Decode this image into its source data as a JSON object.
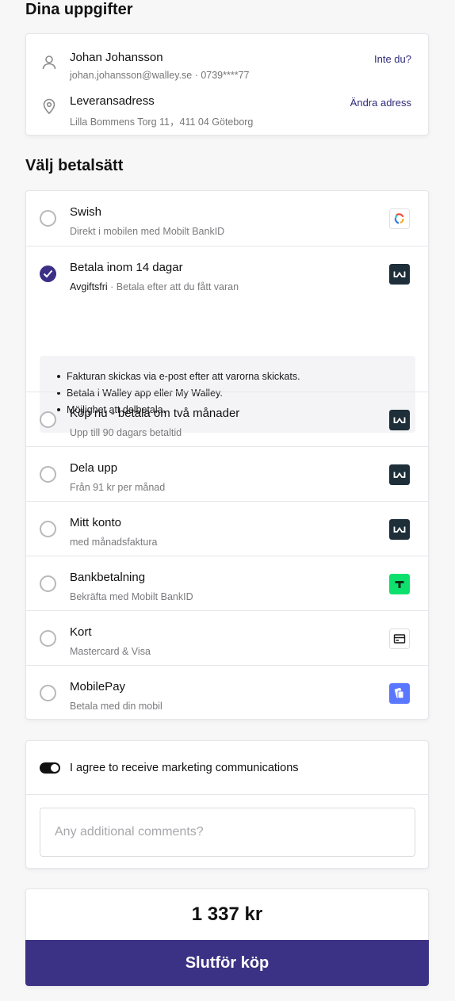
{
  "details": {
    "heading": "Dina uppgifter",
    "name": "Johan Johansson",
    "contact": "johan.johansson@walley.se · 0739****77",
    "not_you_label": "Inte du?",
    "address_title": "Leveransadress",
    "address": "Lilla Bommens Torg 11，411 04 Göteborg",
    "change_address_label": "Ändra adress"
  },
  "payment": {
    "heading": "Välj betalsätt",
    "methods": [
      {
        "title": "Swish",
        "subtitle": "Direkt i mobilen med Mobilt BankID",
        "icon": "swish-logo-icon",
        "selected": false
      },
      {
        "title": "Betala inom 14 dagar",
        "badge": "Avgiftsfri",
        "subtitle": " · Betala efter att du fått varan",
        "icon": "walley-logo-icon",
        "selected": true
      },
      {
        "title": "Köp nu - betala om två månader",
        "subtitle": "Upp till 90 dagars betaltid",
        "icon": "walley-logo-icon",
        "selected": false
      },
      {
        "title": "Dela upp",
        "subtitle": "Från 91 kr per månad",
        "icon": "walley-logo-icon",
        "selected": false
      },
      {
        "title": "Mitt konto",
        "subtitle": "med månadsfaktura",
        "icon": "walley-logo-icon",
        "selected": false
      },
      {
        "title": "Bankbetalning",
        "subtitle": "Bekräfta med Mobilt BankID",
        "icon": "trustly-logo-icon",
        "selected": false
      },
      {
        "title": "Kort",
        "subtitle": "Mastercard & Visa",
        "icon": "card-icon",
        "selected": false
      },
      {
        "title": "MobilePay",
        "subtitle": "Betala med din mobil",
        "icon": "mobilepay-logo-icon",
        "selected": false
      }
    ],
    "selected_details": [
      "Fakturan skickas via e-post efter att varorna skickats.",
      "Betala i Walley app eller My Walley.",
      "Möjlighet att delbetala."
    ]
  },
  "extras": {
    "marketing_label": "I agree to receive marketing communications",
    "marketing_on": true,
    "comments_placeholder": "Any additional comments?",
    "comments_value": ""
  },
  "checkout": {
    "total": "1 337 kr",
    "submit_label": "Slutför köp"
  },
  "colors": {
    "accent": "#3b3285",
    "walley": "#1e2f3a",
    "trustly": "#0ee06e",
    "mobilepay": "#5a78ff",
    "link": "#2e2a7a"
  }
}
